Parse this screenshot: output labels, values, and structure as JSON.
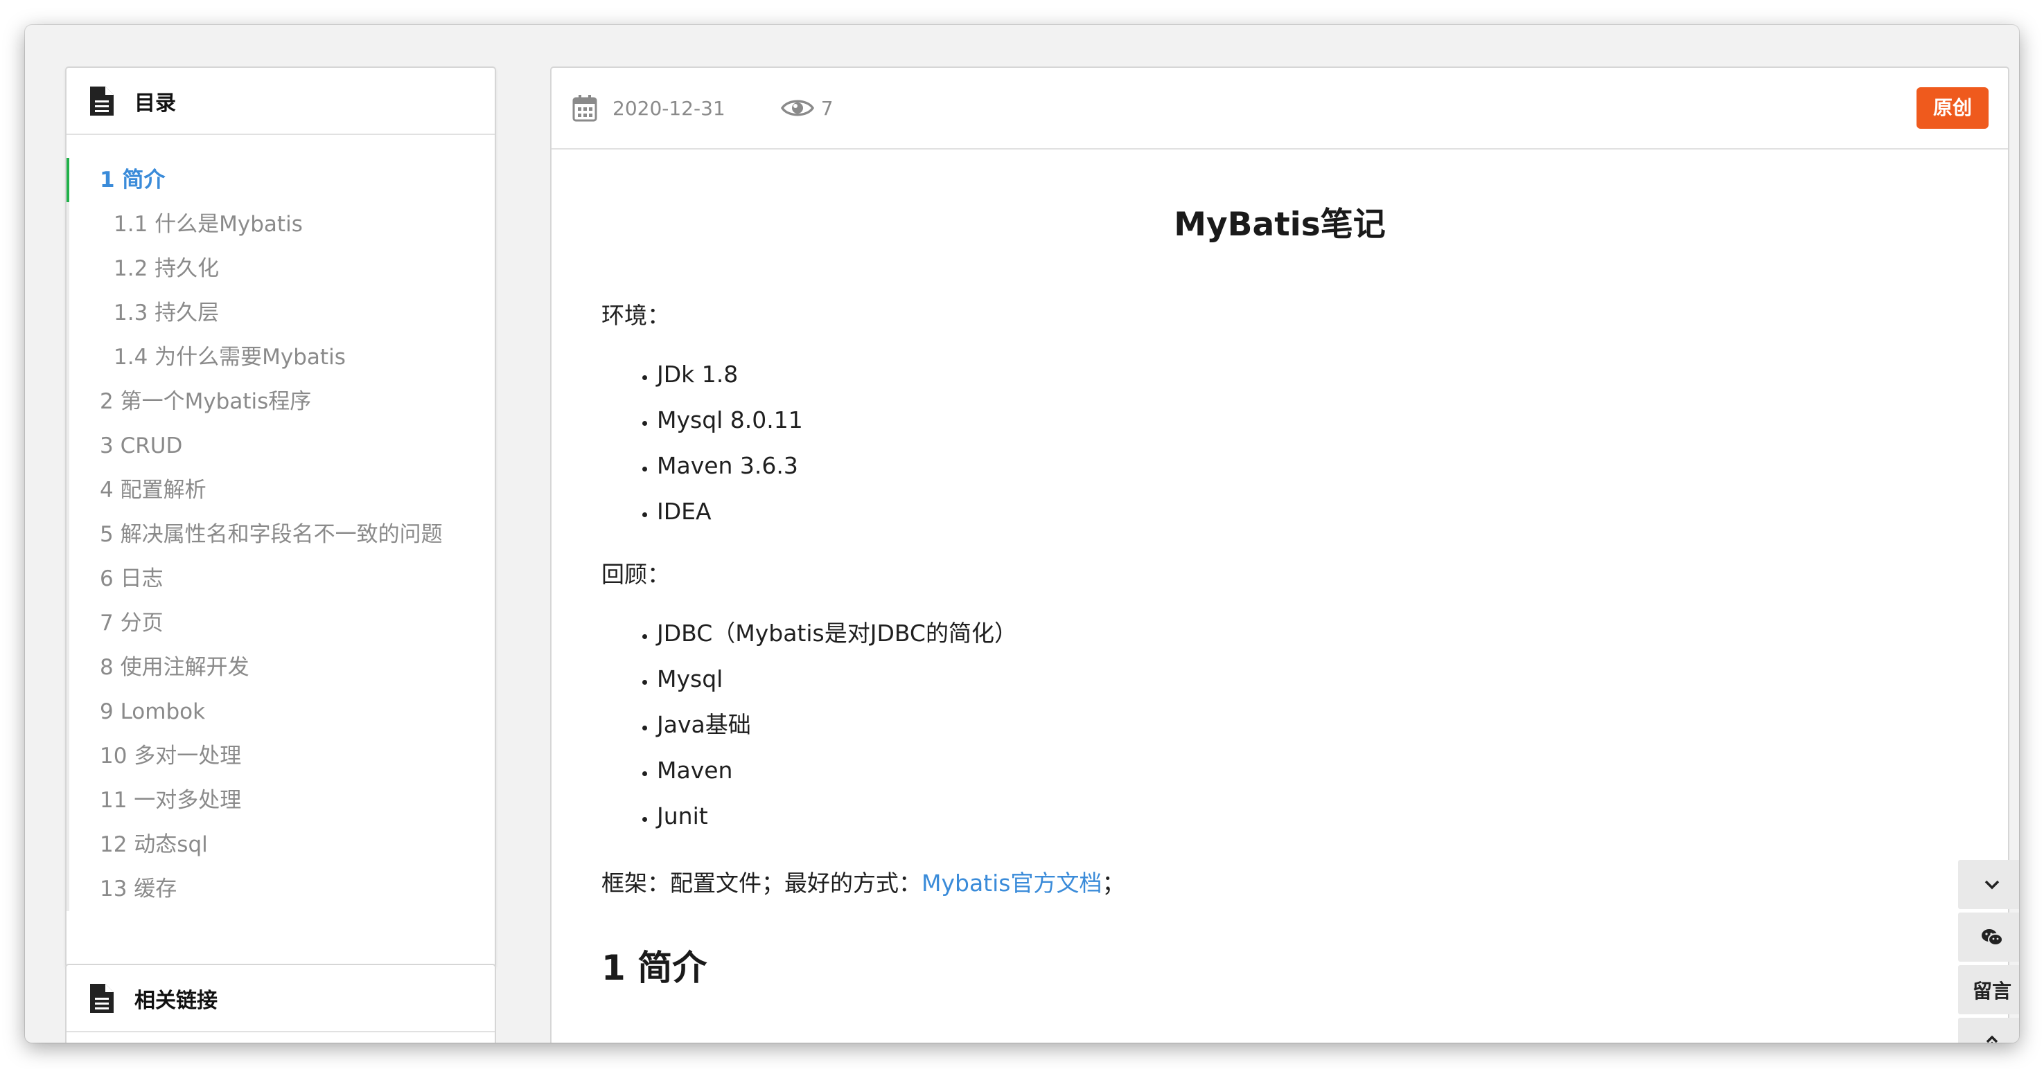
{
  "toc": {
    "title": "目录",
    "items": [
      {
        "label": "1 简介"
      },
      {
        "label": "1.1 什么是Mybatis"
      },
      {
        "label": "1.2 持久化"
      },
      {
        "label": "1.3 持久层"
      },
      {
        "label": "1.4 为什么需要Mybatis"
      },
      {
        "label": "2 第一个Mybatis程序"
      },
      {
        "label": "3 CRUD"
      },
      {
        "label": "4 配置解析"
      },
      {
        "label": "5 解决属性名和字段名不一致的问题"
      },
      {
        "label": "6 日志"
      },
      {
        "label": "7 分页"
      },
      {
        "label": "8 使用注解开发"
      },
      {
        "label": "9 Lombok"
      },
      {
        "label": "10 多对一处理"
      },
      {
        "label": "11 一对多处理"
      },
      {
        "label": "12 动态sql"
      },
      {
        "label": "13 缓存"
      }
    ],
    "active_index": 0,
    "active_color": "#3a8bd9",
    "active_bar_color": "#21b14a"
  },
  "links": {
    "title": "相关链接"
  },
  "article": {
    "date": "2020-12-31",
    "views": "7",
    "badge": "原创",
    "badge_color": "#ef5a1d",
    "title": "MyBatis笔记",
    "env_label": "环境：",
    "env_items": [
      "JDk 1.8",
      "Mysql 8.0.11",
      "Maven 3.6.3",
      "IDEA"
    ],
    "review_label": "回顾：",
    "review_items": [
      "JDBC（Mybatis是对JDBC的简化）",
      "Mysql",
      "Java基础",
      "Maven",
      "Junit"
    ],
    "framework_prefix": "框架：配置文件；最好的方式：",
    "framework_link": "Mybatis官方文档",
    "framework_suffix": "；",
    "section_heading": "1 简介"
  },
  "float_bar": {
    "down_icon": "chevron-down-icon",
    "wechat_icon": "wechat-icon",
    "comment_label": "留言",
    "top_icon": "double-chevron-up-icon"
  }
}
